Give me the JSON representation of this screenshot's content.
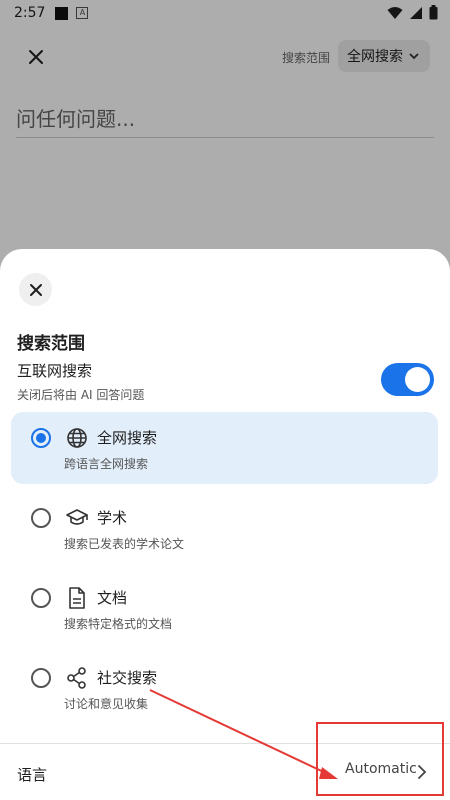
{
  "status_bar": {
    "time": "2:57",
    "app_badge": "A"
  },
  "background": {
    "scope_label": "搜索范围",
    "scope_value": "全网搜索",
    "input_placeholder": "问任何问题..."
  },
  "sheet": {
    "title": "搜索范围",
    "web_search": {
      "label": "互联网搜索",
      "sub": "关闭后将由 AI 回答问题",
      "enabled": true
    },
    "options": [
      {
        "label": "全网搜索",
        "sub": "跨语言全网搜索",
        "icon": "globe-icon",
        "selected": true
      },
      {
        "label": "学术",
        "sub": "搜索已发表的学术论文",
        "icon": "graduation-cap-icon",
        "selected": false
      },
      {
        "label": "文档",
        "sub": "搜索特定格式的文档",
        "icon": "document-icon",
        "selected": false
      },
      {
        "label": "社交搜索",
        "sub": "讨论和意见收集",
        "icon": "share-icon",
        "selected": false
      }
    ],
    "language": {
      "label": "语言",
      "value": "Automatic"
    }
  },
  "colors": {
    "accent": "#1a73e8",
    "selected_bg": "#e3eefb",
    "annotation": "#e53935"
  }
}
